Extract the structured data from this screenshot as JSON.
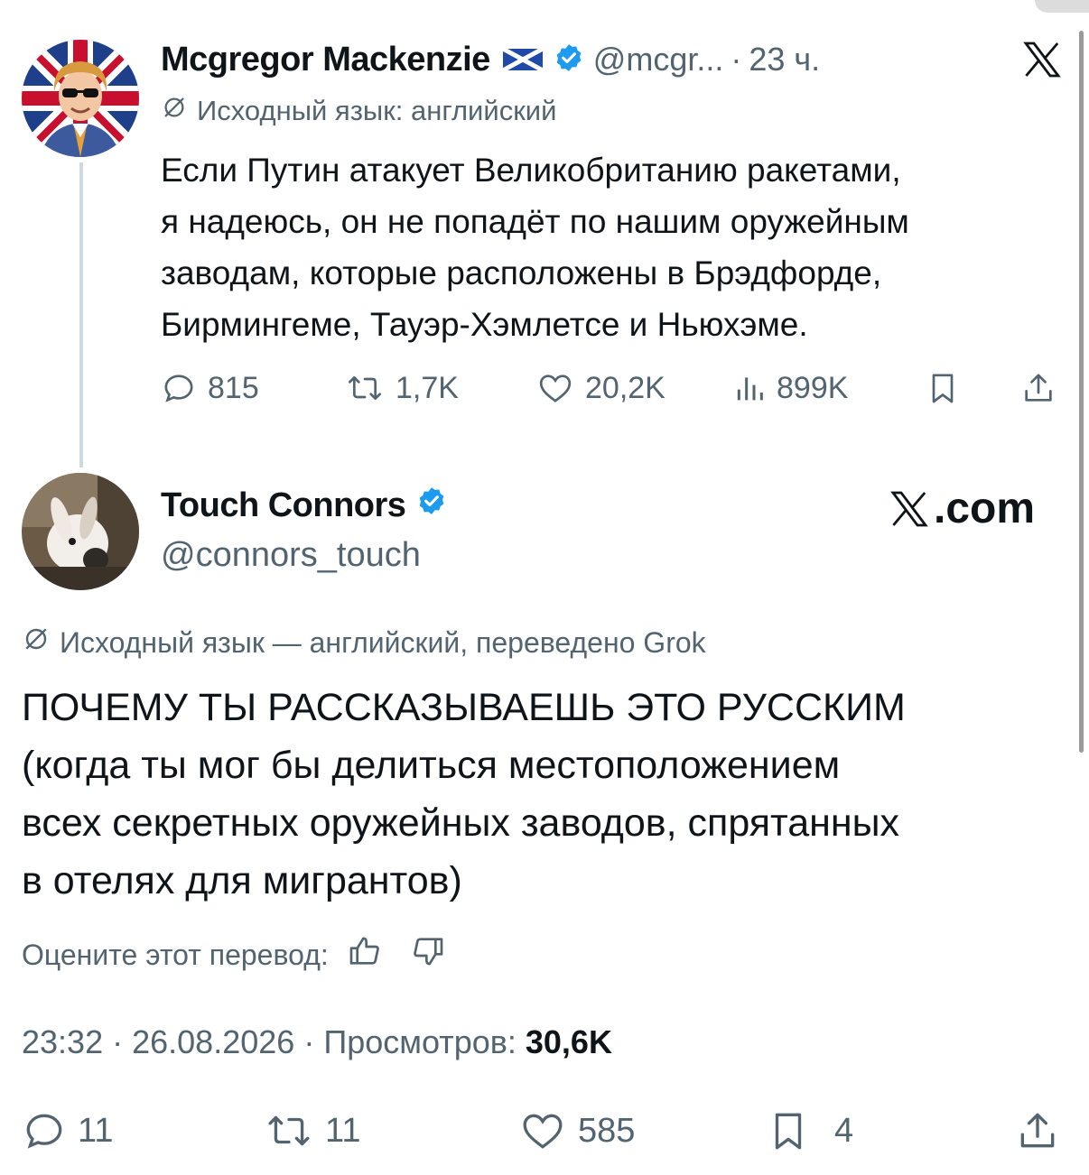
{
  "tweet1": {
    "author_name": "Mcgregor Mackenzie",
    "flag_icon": "scotland-flag-icon",
    "handle": "@mcgr...",
    "separator": "·",
    "time": "23 ч.",
    "translated_from": "Исходный язык: английский",
    "body_lines": [
      "Если Путин атакует Великобританию ракетами,",
      "я надеюсь, он не попадёт по нашим оружейным",
      "заводам, которые расположены в Брэдфорде,",
      "Бирмингеме, Тауэр-Хэмлетсе и Ньюхэме."
    ],
    "actions": {
      "replies": "815",
      "reposts": "1,7K",
      "likes": "20,2K",
      "views": "899K"
    }
  },
  "tweet2": {
    "author_name": "Touch Connors",
    "handle": "@connors_touch",
    "watermark": ".com",
    "translated_from": "Исходный язык — английский, переведено Grok",
    "body_lines": [
      "ПОЧЕМУ ТЫ РАССКАЗЫВАЕШЬ ЭТО РУССКИМ",
      "(когда ты мог бы делиться местоположением",
      "всех секретных оружейных заводов, спрятанных",
      "в отелях для мигрантов)"
    ],
    "rate_translation": "Оцените этот перевод:",
    "meta": {
      "time": "23:32",
      "date": "26.08.2026",
      "views_label": "Просмотров:",
      "views_value": "30,6K"
    },
    "actions": {
      "replies": "11",
      "reposts": "11",
      "likes": "585",
      "bookmarks": "4"
    }
  },
  "colors": {
    "text": "#0f1419",
    "secondary": "#536471",
    "verified": "#1d9bf0",
    "thread_line": "#cfd9de"
  }
}
